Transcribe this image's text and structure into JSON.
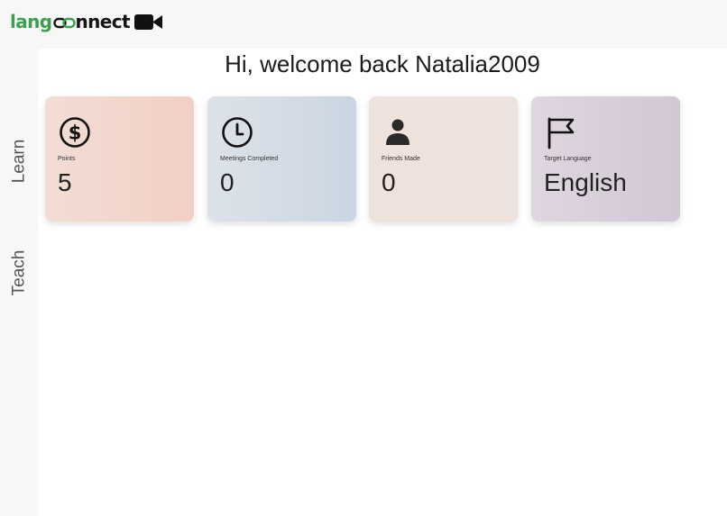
{
  "header": {
    "logo_part1": "lang",
    "logo_part2": "nnect",
    "logo_icon": "chain-link-icon",
    "video_icon": "video-camera-icon"
  },
  "sidebar": {
    "items": [
      {
        "label": "Learn"
      },
      {
        "label": "Teach"
      }
    ]
  },
  "main": {
    "greeting": "Hi, welcome back Natalia2009",
    "cards": [
      {
        "icon": "dollar-icon",
        "label": "Points",
        "value": "5"
      },
      {
        "icon": "clock-icon",
        "label": "Meetings Completed",
        "value": "0"
      },
      {
        "icon": "person-icon",
        "label": "Friends Made",
        "value": "0"
      },
      {
        "icon": "flag-icon",
        "label": "Target Language",
        "value": "English"
      }
    ]
  },
  "colors": {
    "brand_green": "#3f9e4f",
    "text_dark": "#1c1c1c",
    "card_points": "#f2d5cb",
    "card_meetings": "#d3dbe5",
    "card_friends": "#eee2dc",
    "card_language": "#d8cedb"
  }
}
